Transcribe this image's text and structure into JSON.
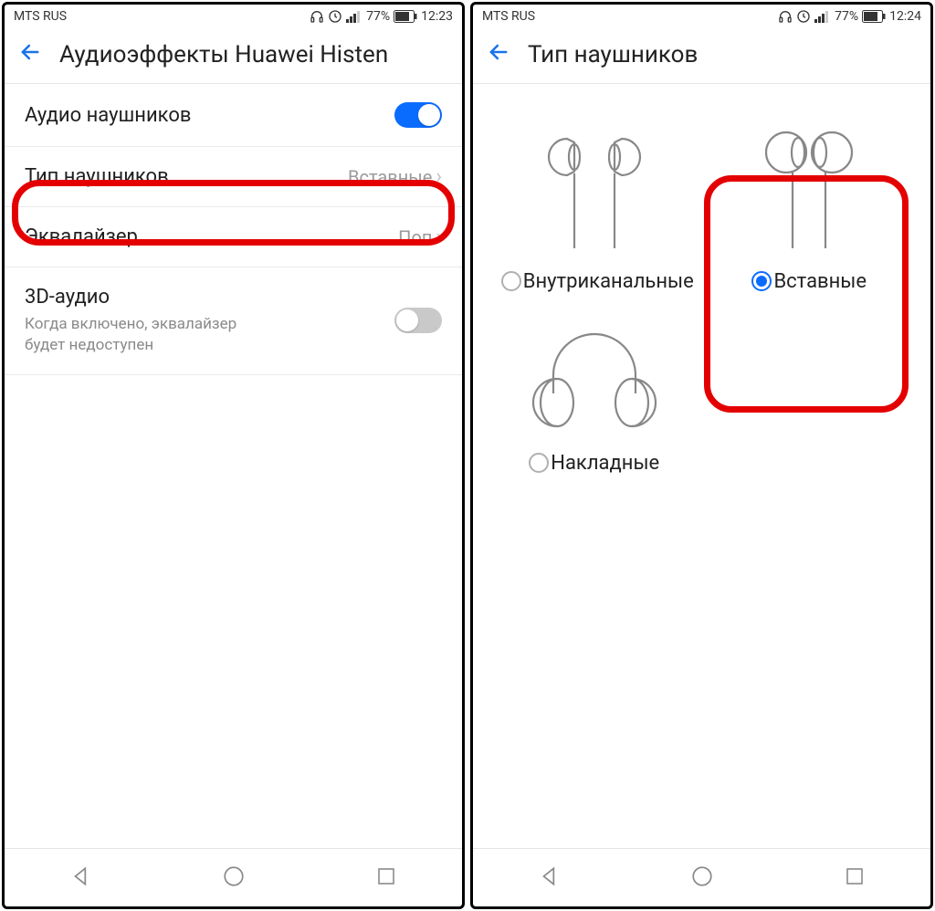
{
  "left": {
    "status": {
      "carrier": "MTS RUS",
      "battery": "77%",
      "time": "12:23"
    },
    "title": "Аудиоэффекты Huawei Histen",
    "rows": {
      "audio": {
        "label": "Аудио наушников"
      },
      "type": {
        "label": "Тип наушников",
        "value": "Вставные"
      },
      "eq": {
        "label": "Эквалайзер",
        "value": "Поп"
      },
      "three_d": {
        "label": "3D-аудио",
        "sub": "Когда включено, эквалайзер будет недоступен"
      }
    }
  },
  "right": {
    "status": {
      "carrier": "MTS RUS",
      "battery": "77%",
      "time": "12:24"
    },
    "title": "Тип наушников",
    "options": {
      "in_ear": {
        "label": "Внутриканальные",
        "selected": false
      },
      "earbuds": {
        "label": "Вставные",
        "selected": true
      },
      "over_ear": {
        "label": "Накладные",
        "selected": false
      }
    }
  }
}
